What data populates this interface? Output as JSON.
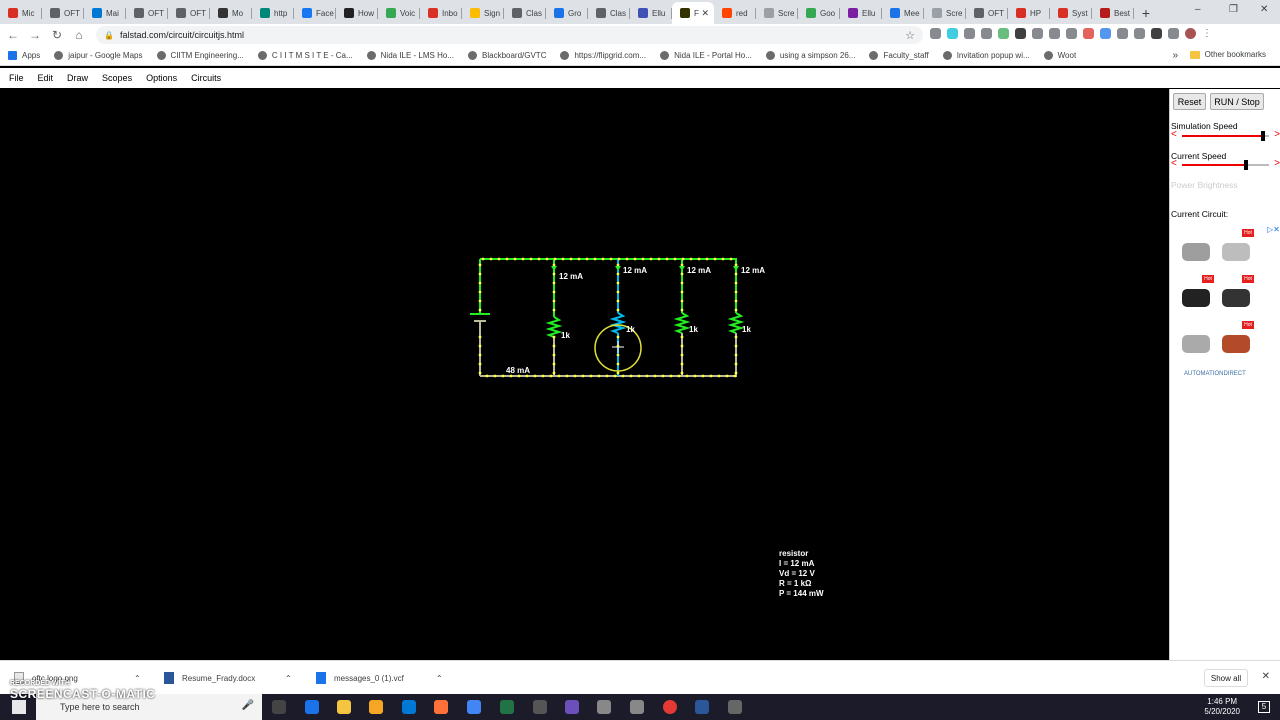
{
  "browser": {
    "tabs": [
      {
        "label": "Mic",
        "color": "#d93025"
      },
      {
        "label": "OFT",
        "color": "#5f6368"
      },
      {
        "label": "Mai",
        "color": "#0078d4"
      },
      {
        "label": "OFT",
        "color": "#5f6368"
      },
      {
        "label": "OFT",
        "color": "#5f6368"
      },
      {
        "label": "Mo",
        "color": "#333333"
      },
      {
        "label": "http",
        "color": "#00897b"
      },
      {
        "label": "Face",
        "color": "#1877f2"
      },
      {
        "label": "How",
        "color": "#222222"
      },
      {
        "label": "Voic",
        "color": "#34a853"
      },
      {
        "label": "Inbo",
        "color": "#d93025"
      },
      {
        "label": "Sign",
        "color": "#fbbc04"
      },
      {
        "label": "Clas",
        "color": "#5f6368"
      },
      {
        "label": "Gro",
        "color": "#1a73e8"
      },
      {
        "label": "Clas",
        "color": "#5f6368"
      },
      {
        "label": "Ellu",
        "color": "#3f51b5"
      },
      {
        "label": "F",
        "color": "#333300",
        "active": true
      },
      {
        "label": "red",
        "color": "#ff4500"
      },
      {
        "label": "Scre",
        "color": "#9aa0a6"
      },
      {
        "label": "Goo",
        "color": "#34a853"
      },
      {
        "label": "Ellu",
        "color": "#7b1fa2"
      },
      {
        "label": "Mee",
        "color": "#1a73e8"
      },
      {
        "label": "Scre",
        "color": "#9aa0a6"
      },
      {
        "label": "OFT",
        "color": "#5f6368"
      },
      {
        "label": "HP",
        "color": "#d93025"
      },
      {
        "label": "Syst",
        "color": "#d93025"
      },
      {
        "label": "Best",
        "color": "#b71c1c"
      }
    ],
    "new_tab": "+",
    "window_controls": [
      "–",
      "❐",
      "✕"
    ],
    "url": "falstad.com/circuit/circuitjs.html",
    "bookmarks": [
      "Apps",
      "jaipur - Google Maps",
      "CIITM Engineering...",
      "C I I T M S I T E - Ca...",
      "Nida ILE - LMS Ho...",
      "Blackboard/GVTC",
      "https://flipgrid.com...",
      "Nida ILE - Portal Ho...",
      "using a simpson 26...",
      "Faculty_staff",
      "Invitation popup wi...",
      "Woot"
    ],
    "other_bookmarks": "Other bookmarks",
    "bookmark_overflow": "»"
  },
  "app": {
    "menu": [
      "File",
      "Edit",
      "Draw",
      "Scopes",
      "Options",
      "Circuits"
    ]
  },
  "circuit": {
    "labels": {
      "branch1_current": "12 mA",
      "branch2_current": "12 mA",
      "branch3_current": "12 mA",
      "branch4_current": "12 mA",
      "total_current": "48 mA",
      "r1": "1k",
      "r2": "1k",
      "r3": "1k",
      "r4": "1k"
    },
    "colors": {
      "wire_high": "#22ee22",
      "wire_low": "#bbbb99",
      "current_dot": "#ffff44",
      "resistor_selected": "#00bbee",
      "selection_circle": "#dddd33"
    }
  },
  "info": {
    "lines": [
      "resistor",
      "I = 12 mA",
      "Vd = 12 V",
      "R = 1 kΩ",
      "P = 144 mW"
    ]
  },
  "sidebar": {
    "reset": "Reset",
    "run_stop": "RUN / Stop",
    "simulation_speed": "Simulation Speed",
    "current_speed": "Current Speed",
    "power_brightness": "Power Brightness",
    "current_circuit": "Current Circuit:",
    "ad_badge": "Hot",
    "ad_brand": "AUTOMATIONDIRECT",
    "ad_choices": "▷✕",
    "sim_speed_level": 0.93,
    "current_speed_level": 0.73
  },
  "downloads": [
    {
      "name": "oftc logo.png"
    },
    {
      "name": "Resume_Frady.docx"
    },
    {
      "name": "messages_0 (1).vcf"
    }
  ],
  "downloads_show_all": "Show all",
  "taskbar": {
    "search_placeholder": "Type here to search",
    "time": "1:46 PM",
    "date": "5/20/2020",
    "notification_count": "5"
  },
  "watermark": {
    "line1": "RECORDED WITH",
    "line2": "SCREENCAST-O-MATIC"
  }
}
